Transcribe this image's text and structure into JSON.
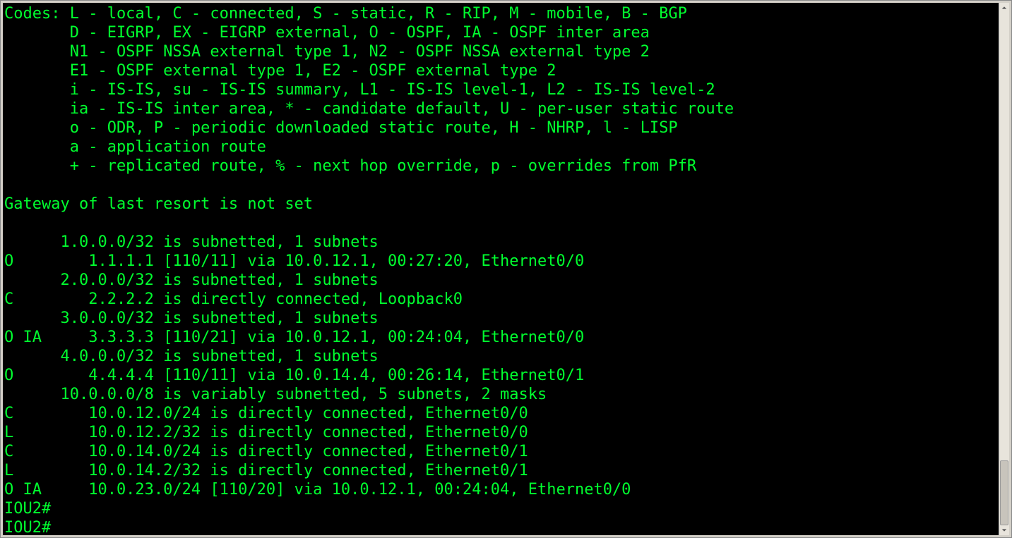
{
  "terminal": {
    "codes": [
      "Codes: L - local, C - connected, S - static, R - RIP, M - mobile, B - BGP",
      "       D - EIGRP, EX - EIGRP external, O - OSPF, IA - OSPF inter area",
      "       N1 - OSPF NSSA external type 1, N2 - OSPF NSSA external type 2",
      "       E1 - OSPF external type 1, E2 - OSPF external type 2",
      "       i - IS-IS, su - IS-IS summary, L1 - IS-IS level-1, L2 - IS-IS level-2",
      "       ia - IS-IS inter area, * - candidate default, U - per-user static route",
      "       o - ODR, P - periodic downloaded static route, H - NHRP, l - LISP",
      "       a - application route",
      "       + - replicated route, % - next hop override, p - overrides from PfR"
    ],
    "gateway": "Gateway of last resort is not set",
    "routes": [
      "      1.0.0.0/32 is subnetted, 1 subnets",
      "O        1.1.1.1 [110/11] via 10.0.12.1, 00:27:20, Ethernet0/0",
      "      2.0.0.0/32 is subnetted, 1 subnets",
      "C        2.2.2.2 is directly connected, Loopback0",
      "      3.0.0.0/32 is subnetted, 1 subnets",
      "O IA     3.3.3.3 [110/21] via 10.0.12.1, 00:24:04, Ethernet0/0",
      "      4.0.0.0/32 is subnetted, 1 subnets",
      "O        4.4.4.4 [110/11] via 10.0.14.4, 00:26:14, Ethernet0/1",
      "      10.0.0.0/8 is variably subnetted, 5 subnets, 2 masks",
      "C        10.0.12.0/24 is directly connected, Ethernet0/0",
      "L        10.0.12.2/32 is directly connected, Ethernet0/0",
      "C        10.0.14.0/24 is directly connected, Ethernet0/1",
      "L        10.0.14.2/32 is directly connected, Ethernet0/1",
      "O IA     10.0.23.0/24 [110/20] via 10.0.12.1, 00:24:04, Ethernet0/0"
    ],
    "prompts": [
      "IOU2#",
      "IOU2#"
    ]
  }
}
